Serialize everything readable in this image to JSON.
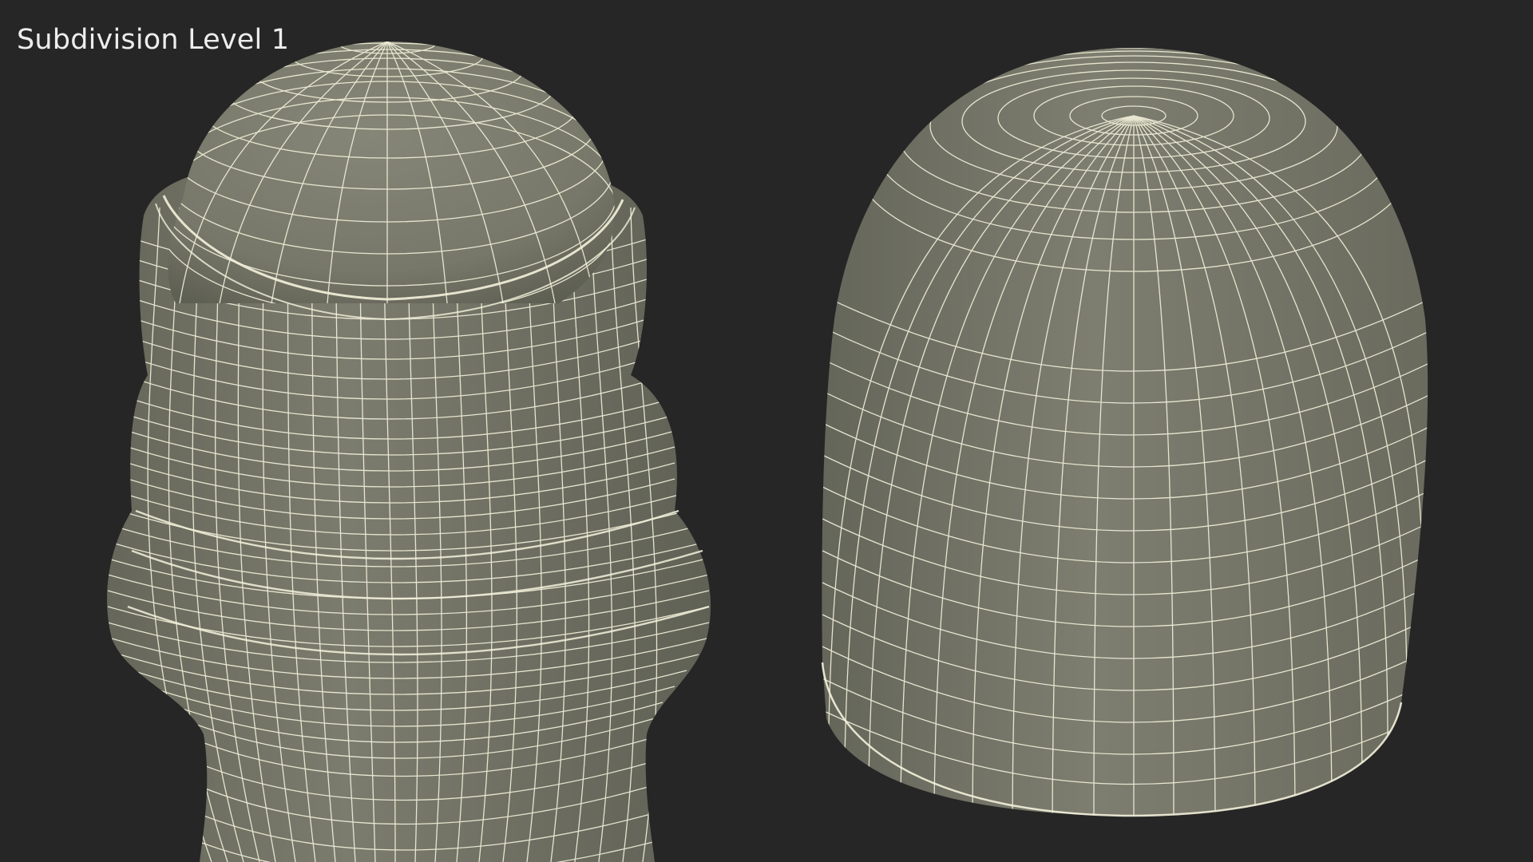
{
  "viewport": {
    "caption": "Subdivision Level 1"
  },
  "colors": {
    "background": "#262626",
    "surface": "#797a6c",
    "wire": "#f4f2dc"
  }
}
